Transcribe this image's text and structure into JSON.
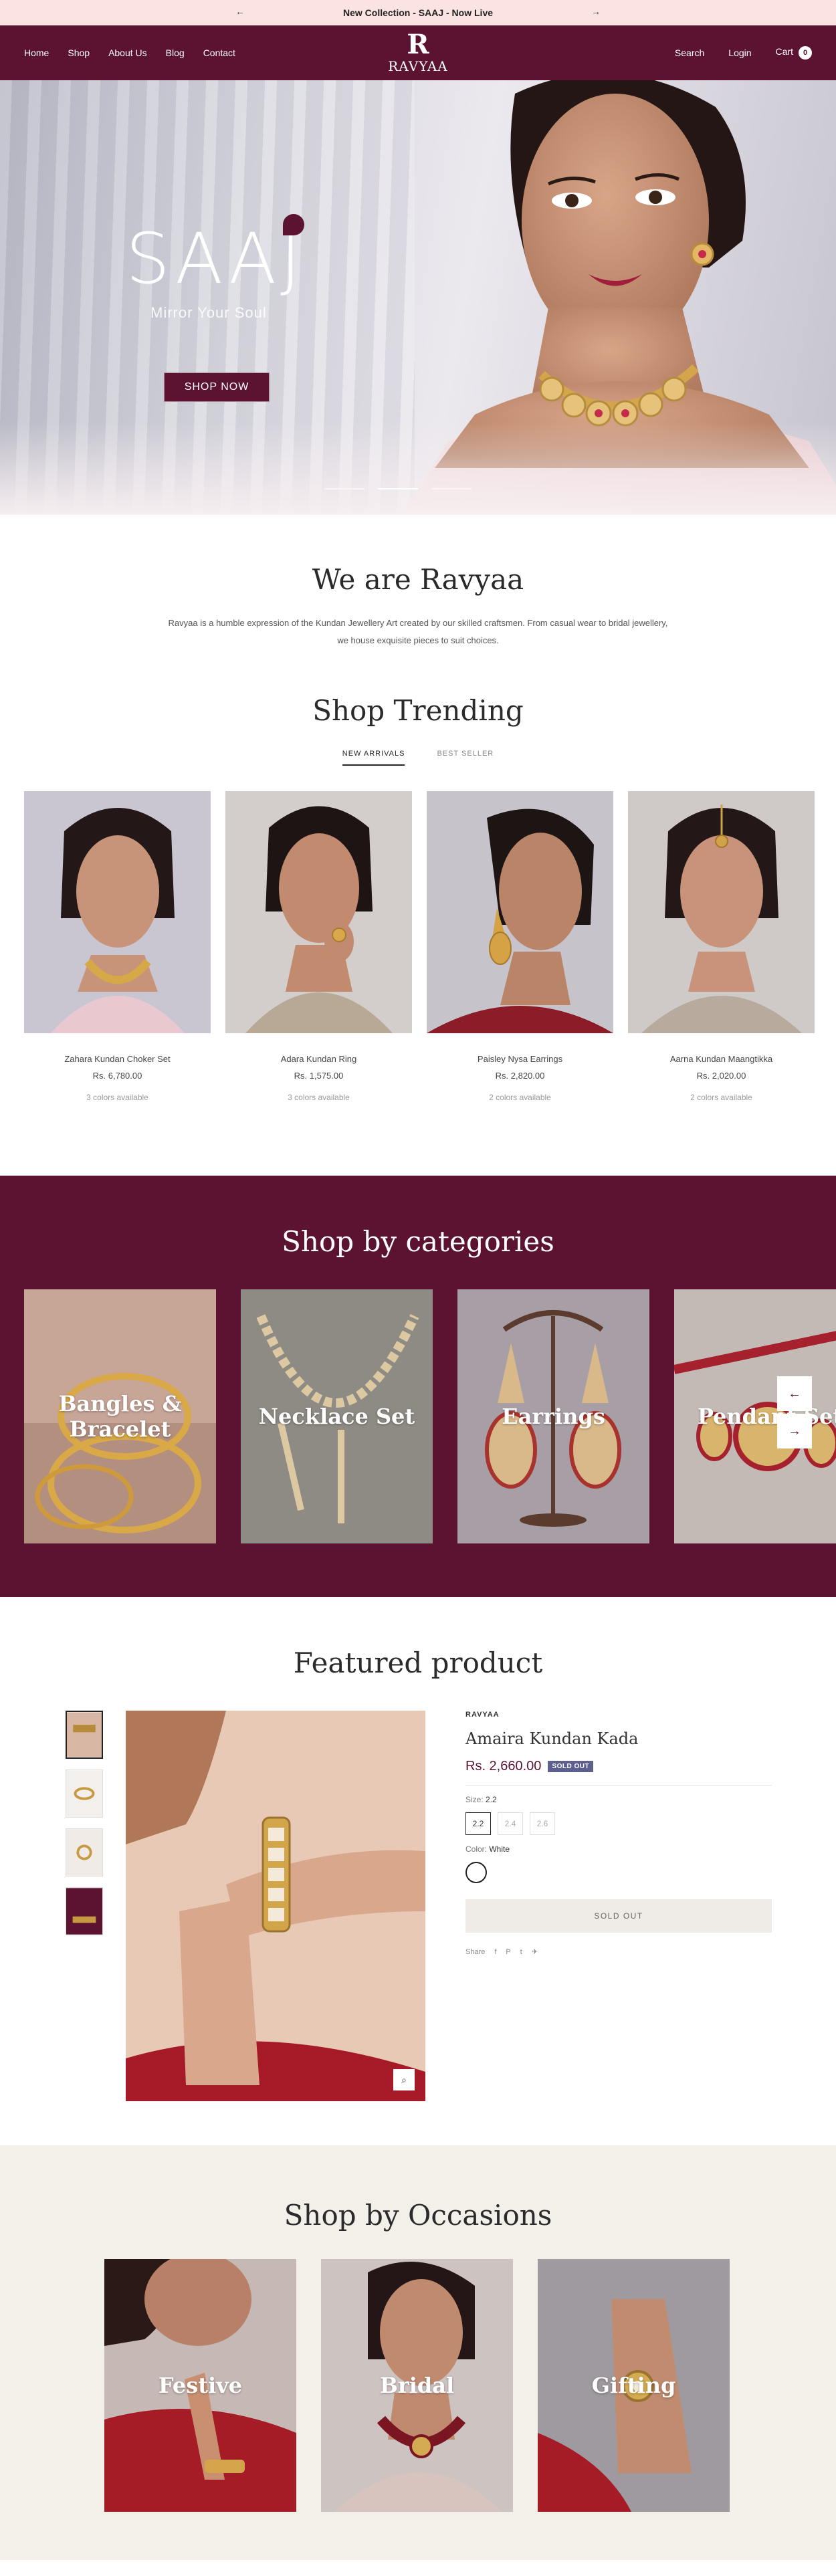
{
  "announcement": {
    "prev_icon": "arrow-left-icon",
    "text": "New Collection - SAAJ - Now Live",
    "next_icon": "arrow-right-icon"
  },
  "header": {
    "nav": [
      "Home",
      "Shop",
      "About Us",
      "Blog",
      "Contact"
    ],
    "logo_mark": "R",
    "logo_text": "RAVYAA",
    "search": "Search",
    "login": "Login",
    "cart": "Cart",
    "cart_count": "0"
  },
  "hero": {
    "title": "SAAJ",
    "tagline": "Mirror Your Soul",
    "cta": "SHOP NOW"
  },
  "about": {
    "title": "We are Ravyaa",
    "line1": "Ravyaa is a humble expression of the Kundan Jewellery Art created by our skilled craftsmen. From casual wear to bridal jewellery,",
    "line2": "we house exquisite pieces to suit choices."
  },
  "trending": {
    "title": "Shop Trending",
    "tabs": [
      "NEW ARRIVALS",
      "BEST SELLER"
    ],
    "products": [
      {
        "name": "Zahara Kundan Choker Set",
        "price": "Rs. 6,780.00",
        "colors": "3 colors available"
      },
      {
        "name": "Adara Kundan Ring",
        "price": "Rs. 1,575.00",
        "colors": "3 colors available"
      },
      {
        "name": "Paisley Nysa Earrings",
        "price": "Rs. 2,820.00",
        "colors": "2 colors available"
      },
      {
        "name": "Aarna Kundan Maangtikka",
        "price": "Rs. 2,020.00",
        "colors": "2 colors available"
      }
    ]
  },
  "categories": {
    "title": "Shop by categories",
    "items": [
      {
        "line1": "Bangles &",
        "line2": "Bracelet"
      },
      {
        "line1": "Necklace Set",
        "line2": ""
      },
      {
        "line1": "Earrings",
        "line2": ""
      },
      {
        "line1": "Pendant Set",
        "line2": ""
      }
    ],
    "prev_icon": "arrow-left-icon",
    "next_icon": "arrow-right-icon"
  },
  "featured": {
    "title": "Featured product",
    "brand": "RAVYAA",
    "name": "Amaira Kundan Kada",
    "price": "Rs. 2,660.00",
    "badge": "SOLD OUT",
    "size_label": "Size:",
    "size_value": "2.2",
    "sizes": [
      "2.2",
      "2.4",
      "2.6"
    ],
    "color_label": "Color:",
    "color_value": "White",
    "button": "SOLD OUT",
    "share": "Share",
    "share_icons": [
      "f",
      "P",
      "t",
      "✈"
    ]
  },
  "occasions": {
    "title": "Shop by Occasions",
    "items": [
      "Festive",
      "Bridal",
      "Gifting"
    ]
  },
  "colors": {
    "brand": "#5c1331",
    "announce_bg": "#fbe3e1",
    "occasions_bg": "#f3efe9",
    "badge": "#5d5f8f"
  }
}
